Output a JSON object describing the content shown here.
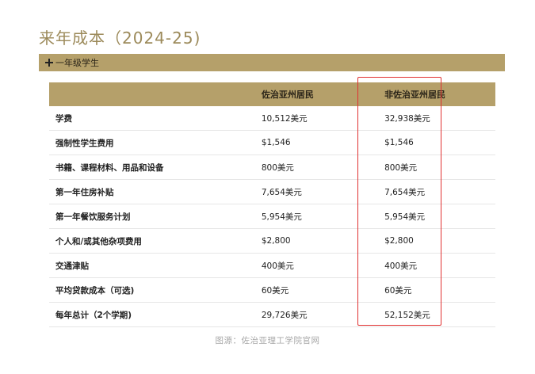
{
  "page": {
    "title": "来年成本（2024-25)",
    "caption": "图源：佐治亚理工学院官网"
  },
  "accordion": {
    "label": "一年级学生",
    "icon": "plus-icon"
  },
  "table": {
    "headers": [
      "",
      "佐治亚州居民",
      "非佐治亚州居民"
    ],
    "rows": [
      {
        "label": "学费",
        "georgia": "10,512美元",
        "non_georgia": "32,938美元"
      },
      {
        "label": "强制性学生费用",
        "georgia": "$1,546",
        "non_georgia": "$1,546"
      },
      {
        "label": "书籍、课程材料、用品和设备",
        "georgia": "800美元",
        "non_georgia": "800美元"
      },
      {
        "label": "第一年住房补贴",
        "georgia": "7,654美元",
        "non_georgia": "7,654美元"
      },
      {
        "label": "第一年餐饮服务计划",
        "georgia": "5,954美元",
        "non_georgia": "5,954美元"
      },
      {
        "label": "个人和/或其他杂项费用",
        "georgia": "$2,800",
        "non_georgia": "$2,800"
      },
      {
        "label": "交通津贴",
        "georgia": "400美元",
        "non_georgia": "400美元"
      },
      {
        "label": "平均贷款成本（可选)",
        "georgia": "60美元",
        "non_georgia": "60美元"
      },
      {
        "label": "每年总计（2个学期)",
        "georgia": "29,726美元",
        "non_georgia": "52,152美元"
      }
    ]
  },
  "colors": {
    "accent": "#b5a06a",
    "title": "#9c8a5a",
    "highlight": "#e03131"
  }
}
